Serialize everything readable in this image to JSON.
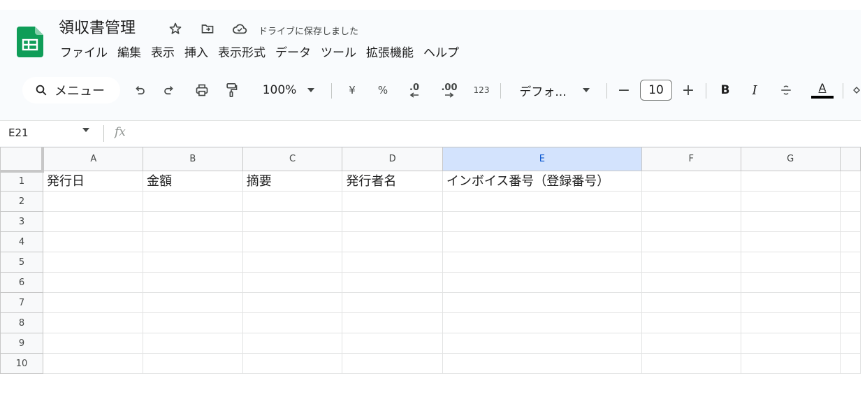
{
  "doc": {
    "title": "領収書管理",
    "save_status": "ドライブに保存しました"
  },
  "menu": [
    "ファイル",
    "編集",
    "表示",
    "挿入",
    "表示形式",
    "データ",
    "ツール",
    "拡張機能",
    "ヘルプ"
  ],
  "toolbar": {
    "menu_search_label": "メニュー",
    "zoom": "100%",
    "currency": "¥",
    "percent": "%",
    "decrease_decimal": ".0",
    "increase_decimal": ".00",
    "number_format": "123",
    "font_name": "デフォ...",
    "font_size": "10",
    "minus": "−",
    "plus": "+",
    "bold": "B",
    "italic": "I",
    "text_color": "A"
  },
  "formula_bar": {
    "cell_ref": "E21",
    "fx": "fx"
  },
  "grid": {
    "columns": [
      "A",
      "B",
      "C",
      "D",
      "E",
      "F",
      "G"
    ],
    "selected_column": "E",
    "rows": [
      {
        "num": "1",
        "cells": [
          "発行日",
          "金額",
          "摘要",
          "発行者名",
          "インボイス番号（登録番号）",
          "",
          ""
        ]
      },
      {
        "num": "2",
        "cells": [
          "",
          "",
          "",
          "",
          "",
          "",
          ""
        ]
      },
      {
        "num": "3",
        "cells": [
          "",
          "",
          "",
          "",
          "",
          "",
          ""
        ]
      },
      {
        "num": "4",
        "cells": [
          "",
          "",
          "",
          "",
          "",
          "",
          ""
        ]
      },
      {
        "num": "5",
        "cells": [
          "",
          "",
          "",
          "",
          "",
          "",
          ""
        ]
      },
      {
        "num": "6",
        "cells": [
          "",
          "",
          "",
          "",
          "",
          "",
          ""
        ]
      },
      {
        "num": "7",
        "cells": [
          "",
          "",
          "",
          "",
          "",
          "",
          ""
        ]
      },
      {
        "num": "8",
        "cells": [
          "",
          "",
          "",
          "",
          "",
          "",
          ""
        ]
      },
      {
        "num": "9",
        "cells": [
          "",
          "",
          "",
          "",
          "",
          "",
          ""
        ]
      },
      {
        "num": "10",
        "cells": [
          "",
          "",
          "",
          "",
          "",
          "",
          ""
        ]
      }
    ]
  },
  "icons": {
    "logo": "sheets-logo",
    "star": "star-icon",
    "move": "move-to-folder-icon",
    "cloud": "cloud-saved-icon"
  },
  "colors": {
    "sheets_green": "#0f9d58",
    "selected_header": "#d3e3fd",
    "selected_header_text": "#0b57d0"
  }
}
